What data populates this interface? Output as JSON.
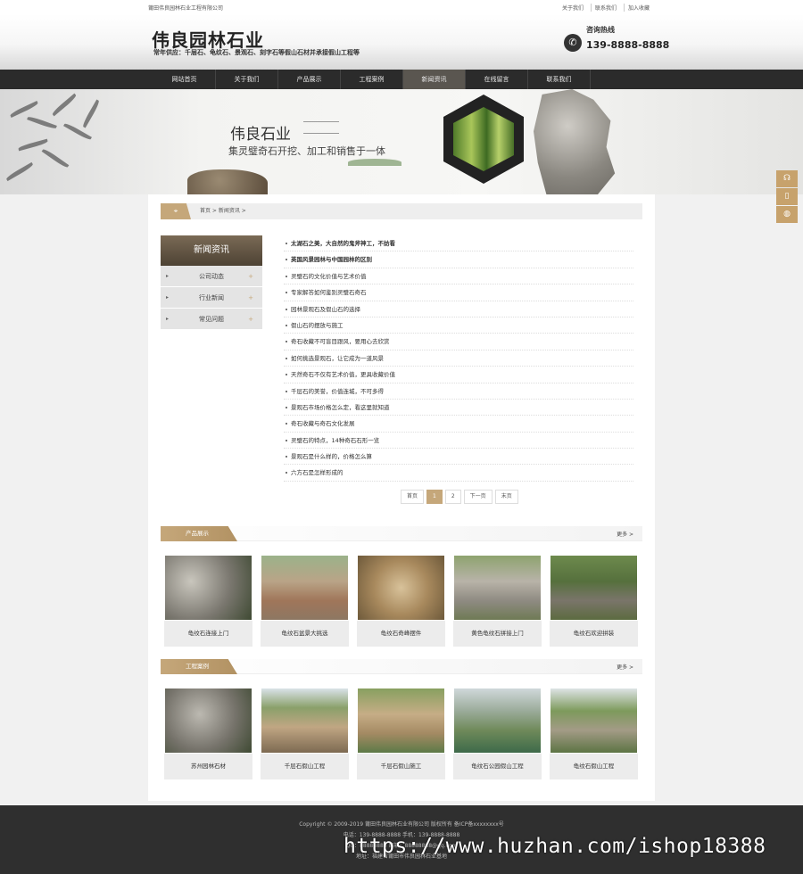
{
  "topbar": {
    "company": "莆田伟良园林石业工程有限公司",
    "links": [
      "关于我们",
      "联系我们",
      "加入收藏"
    ]
  },
  "header": {
    "logo": "伟良园林石业",
    "slogan": "常年供应：千层石、龟纹石、景观石、刻字石等假山石材并承接假山工程等",
    "hotline_label": "咨询热线",
    "hotline_number": "139-8888-8888"
  },
  "nav": {
    "items": [
      "网站首页",
      "关于我们",
      "产品展示",
      "工程案例",
      "新闻资讯",
      "在线留言",
      "联系我们"
    ],
    "active_index": 4
  },
  "banner": {
    "title": "伟良石业",
    "subtitle": "集灵璧奇石开挖、加工和销售于一体"
  },
  "breadcrumb": "首页 > 新闻资讯 >",
  "sidenav": {
    "title": "新闻资讯",
    "items": [
      "公司动态",
      "行业新闻",
      "常见问题"
    ]
  },
  "news": [
    "太湖石之美，大自然的鬼斧神工，不妨看",
    "英国风景园林与中国园林的区别",
    "灵璧石的文化价值与艺术价值",
    "专家解答如何鉴别灵璧石奇石",
    "园林景观石及假山石的选择",
    "假山石的摆放与施工",
    "奇石收藏不可盲目跟风，要用心去欣赏",
    "如何挑选景观石，让它成为一道风景",
    "天然奇石不仅有艺术价值，更具收藏价值",
    "千层石的美誉，价值连城，不可多得",
    "景观石市场价格怎么定，看这里就知道",
    "奇石收藏与奇石文化发展",
    "灵璧石的特点，14种奇石石形一览",
    "景观石是什么样的，价格怎么算",
    "六方石是怎样形成的"
  ],
  "pagination": {
    "first": "首页",
    "pages": [
      "1",
      "2"
    ],
    "current": "1",
    "next": "下一页",
    "last": "末页"
  },
  "products": {
    "title": "产品展示",
    "more": "更多 >",
    "items": [
      "龟纹石连接上门",
      "龟纹石盆景大挑选",
      "龟纹石奇峰摆件",
      "黄色龟纹石拼接上门",
      "龟纹石欢迎拼装"
    ]
  },
  "cases": {
    "title": "工程案例",
    "more": "更多 >",
    "items": [
      "苏州园林石材",
      "千层石假山工程",
      "千层石假山施工",
      "龟纹石公园假山工程",
      "龟纹石假山工程"
    ]
  },
  "footer": {
    "line1": "Copyright © 2009-2019 莆田伟良园林石业有限公司 版权所有 备ICP备xxxxxxxx号",
    "line2": "电话：139-8888-8888  手机：139-8888-8888",
    "line3": "QQ：88888888  邮箱：88888888@qq.com",
    "line4": "地址：福建省莆田市伟良园林石业基地"
  },
  "watermark": "https://www.huzhan.com/ishop18388",
  "colors": {
    "accent": "#c5a77a",
    "nav_bg": "#2b2b2b",
    "footer_bg": "#2f2f2f"
  }
}
